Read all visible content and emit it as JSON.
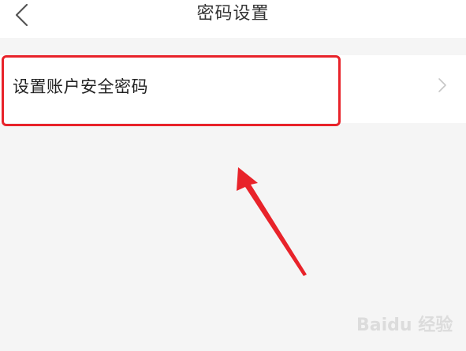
{
  "header": {
    "back_icon": "chevron-left-icon",
    "title": "密码设置"
  },
  "settings": {
    "items": [
      {
        "label": "设置账户安全密码",
        "icon": "chevron-right-icon"
      }
    ]
  },
  "annotation": {
    "highlight_color": "#e8232a",
    "arrow_color": "#e8232a"
  },
  "watermark": {
    "logo_text": "Baidu 经验"
  }
}
